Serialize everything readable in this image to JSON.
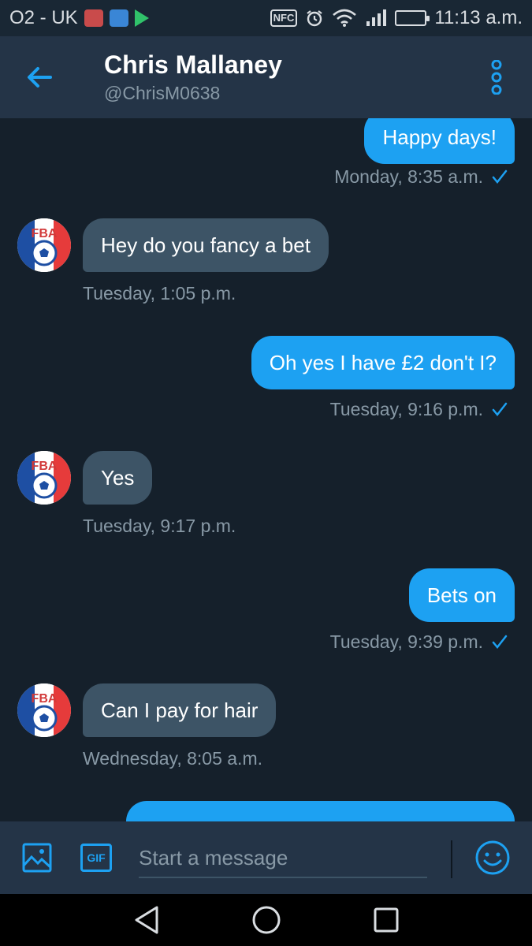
{
  "status_bar": {
    "carrier": "O2 - UK",
    "nfc": "NFC",
    "time": "11:13 a.m."
  },
  "header": {
    "name": "Chris Mallaney",
    "handle": "@ChrisM0638"
  },
  "avatar": {
    "logo_text": "FBA"
  },
  "messages": [
    {
      "type": "sent",
      "text": "Happy days!",
      "time": "Monday, 8:35 a.m."
    },
    {
      "type": "received",
      "text": "Hey do you fancy a bet",
      "time": "Tuesday, 1:05 p.m."
    },
    {
      "type": "sent",
      "text": "Oh yes I have £2 don't I?",
      "time": "Tuesday, 9:16 p.m."
    },
    {
      "type": "received",
      "text": "Yes",
      "time": "Tuesday, 9:17 p.m."
    },
    {
      "type": "sent",
      "text": "Bets on",
      "time": "Tuesday, 9:39 p.m."
    },
    {
      "type": "received",
      "text": "Can I pay for hair",
      "time": "Wednesday, 8:05 a.m."
    },
    {
      "type": "sent",
      "text": "",
      "time": ""
    }
  ],
  "composer": {
    "placeholder": "Start a message",
    "gif_label": "GIF"
  },
  "colors": {
    "background": "#15202b",
    "header": "#243447",
    "accent": "#1da1f2",
    "received_bubble": "#3d5466",
    "muted_text": "#8899a6"
  }
}
